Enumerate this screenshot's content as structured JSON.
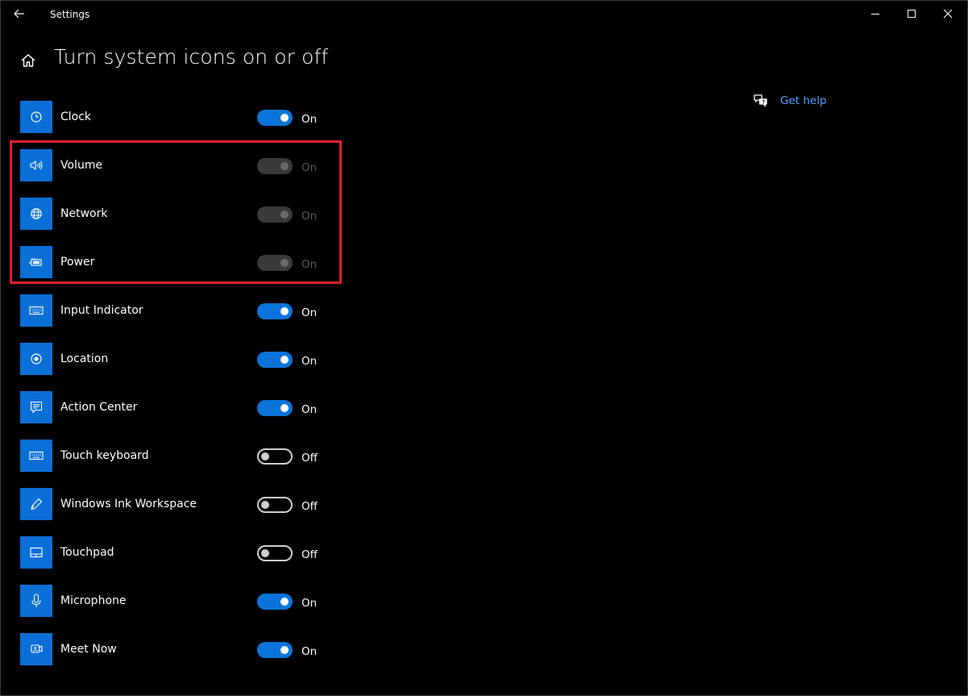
{
  "window": {
    "title": "Settings"
  },
  "page": {
    "title": "Turn system icons on or off"
  },
  "help": {
    "label": "Get help"
  },
  "colors": {
    "accent": "#0a74da",
    "highlight": "#e0202a",
    "link": "#4ea1ff"
  },
  "items": [
    {
      "label": "Clock",
      "icon": "clock-icon",
      "state": "On",
      "enabled": true
    },
    {
      "label": "Volume",
      "icon": "volume-icon",
      "state": "On",
      "enabled": false
    },
    {
      "label": "Network",
      "icon": "globe-icon",
      "state": "On",
      "enabled": false
    },
    {
      "label": "Power",
      "icon": "battery-icon",
      "state": "On",
      "enabled": false
    },
    {
      "label": "Input Indicator",
      "icon": "keyboard-icon",
      "state": "On",
      "enabled": true
    },
    {
      "label": "Location",
      "icon": "location-icon",
      "state": "On",
      "enabled": true
    },
    {
      "label": "Action Center",
      "icon": "action-center-icon",
      "state": "On",
      "enabled": true
    },
    {
      "label": "Touch keyboard",
      "icon": "keyboard-icon",
      "state": "Off",
      "enabled": true
    },
    {
      "label": "Windows Ink Workspace",
      "icon": "pen-icon",
      "state": "Off",
      "enabled": true
    },
    {
      "label": "Touchpad",
      "icon": "touchpad-icon",
      "state": "Off",
      "enabled": true
    },
    {
      "label": "Microphone",
      "icon": "microphone-icon",
      "state": "On",
      "enabled": true
    },
    {
      "label": "Meet Now",
      "icon": "meet-now-icon",
      "state": "On",
      "enabled": true
    }
  ]
}
